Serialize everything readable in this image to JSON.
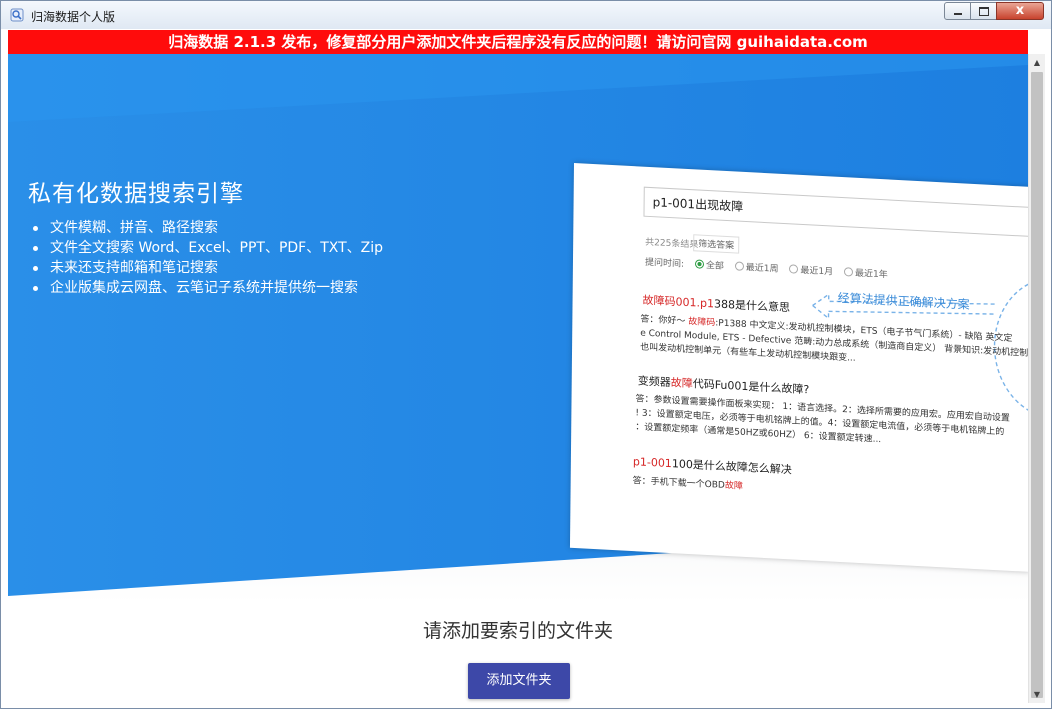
{
  "window": {
    "title": "归海数据个人版",
    "icon": "app-logo-icon",
    "controls": {
      "close": "x"
    }
  },
  "banner": {
    "text": "归海数据 2.1.3 发布，修复部分用户添加文件夹后程序没有反应的问题！请访问官网 guihaidata.com",
    "bg_color": "#ff0c0c"
  },
  "hero": {
    "title": "私有化数据搜索引擎",
    "features": [
      "文件模糊、拼音、路径搜索",
      "文件全文搜索 Word、Excel、PPT、PDF、TXT、Zip",
      "未来还支持邮箱和笔记搜索",
      "企业版集成云网盘、云笔记子系统并提供统一搜索"
    ],
    "bg_color": "#2186e4"
  },
  "preview": {
    "search_text": "p1-001出现故障",
    "result_count": "共225条结果",
    "filter_label": "筛选答案",
    "time_label": "提问时间:",
    "time_options": [
      "全部",
      "最近1周",
      "最近1月",
      "最近1年"
    ],
    "time_selected": "全部",
    "algo_note": "经算法提供正确解决方案",
    "results": [
      {
        "q_pre": "",
        "q_red": "故障码001.p1",
        "q_post": "388是什么意思",
        "a_lines": [
          "答：你好～ 故障码:P1388 中文定义:发动机控制模块，ETS（电子节气门系统）- 缺陷 英文定",
          "e Control Module, ETS - Defective 范畴:动力总成系统（制造商自定义） 背景知识:发动机控制",
          "也叫发动机控制单元（有些车上发动机控制模块跟变..."
        ]
      },
      {
        "q_pre": "变频器",
        "q_red": "故障",
        "q_post": "代码Fu001是什么故障?",
        "a_lines": [
          "答：参数设置需要操作面板来实现： 1：语言选择。2：选择所需要的应用宏。应用宏自动设置",
          "! 3：设置额定电压，必须等于电机铭牌上的值。4：设置额定电流值，必须等于电机铭牌上的",
          "：设置额定频率（通常是50HZ或60HZ） 6：设置额定转速..."
        ]
      },
      {
        "q_pre": "",
        "q_red": "p1-001",
        "q_post": "100是什么故障怎么解决",
        "a_lines": [
          "答：手机下载一个OBD故障"
        ]
      }
    ]
  },
  "cta": {
    "title": "请添加要索引的文件夹",
    "button_label": "添加文件夹",
    "button_color": "#3d48a8"
  }
}
